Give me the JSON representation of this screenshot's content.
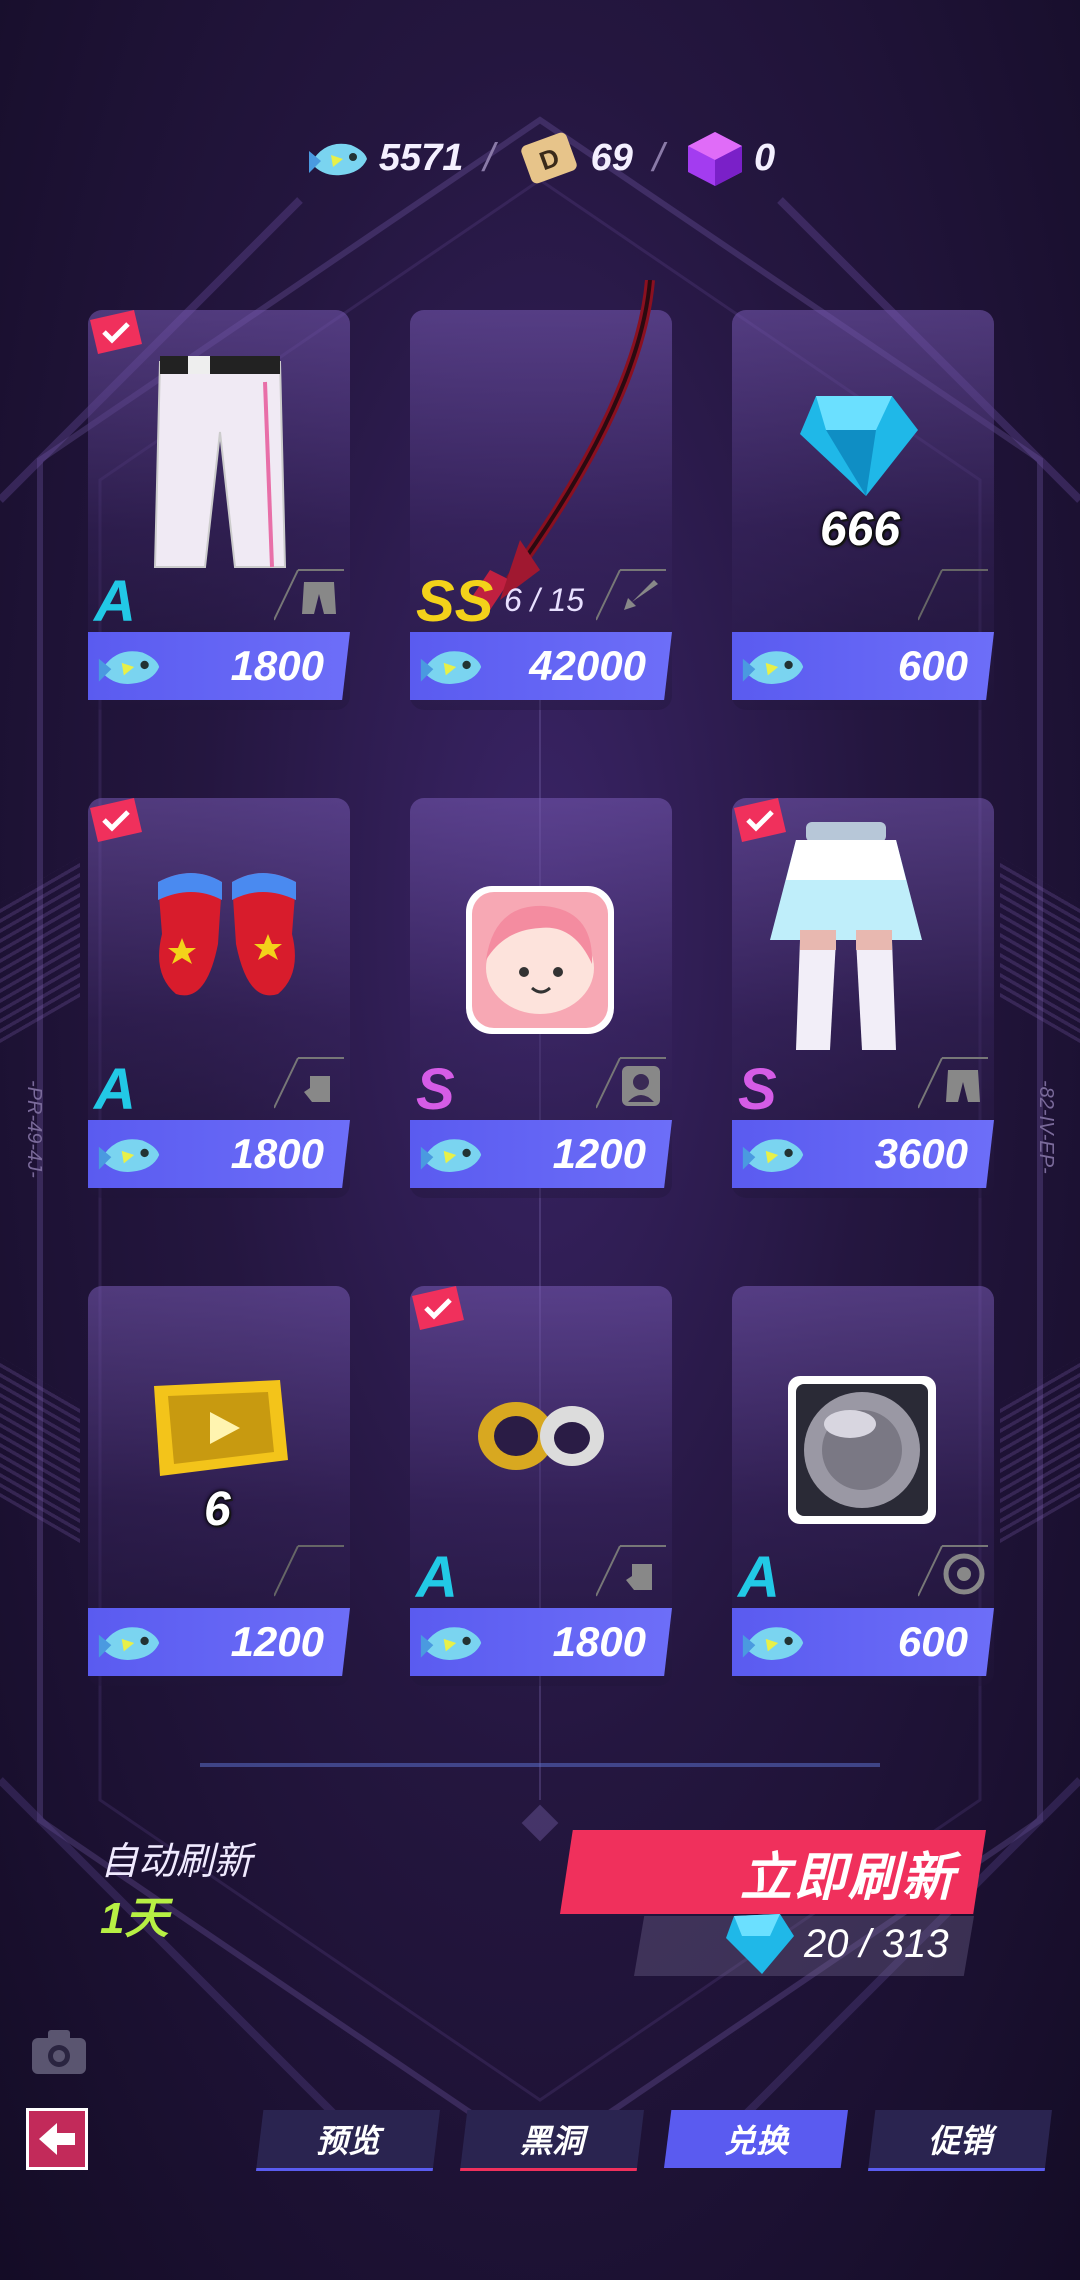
{
  "currencies": [
    {
      "icon": "fish-currency-icon",
      "value": "5571"
    },
    {
      "icon": "ticket-d-icon",
      "value": "69"
    },
    {
      "icon": "purple-cube-icon",
      "value": "0"
    }
  ],
  "separator": "/",
  "items": [
    {
      "name": "white-pants",
      "icon": "white-pants-icon",
      "rank": "A",
      "type_icon": "pants-type-icon",
      "price": "1800",
      "owned": true,
      "qty": "",
      "stock": ""
    },
    {
      "name": "red-scythe",
      "icon": "scythe-weapon-icon",
      "rank": "SS",
      "type_icon": "weapon-type-icon",
      "price": "42000",
      "owned": false,
      "qty": "",
      "stock": "6 / 15"
    },
    {
      "name": "blue-diamond",
      "icon": "diamond-icon",
      "rank": "",
      "type_icon": "",
      "price": "600",
      "owned": false,
      "qty": "666",
      "stock": ""
    },
    {
      "name": "red-gloves",
      "icon": "star-gloves-icon",
      "rank": "A",
      "type_icon": "glove-type-icon",
      "price": "1800",
      "owned": true,
      "qty": "",
      "stock": ""
    },
    {
      "name": "avatar-frame",
      "icon": "pink-avatar-icon",
      "rank": "S",
      "type_icon": "avatar-type-icon",
      "price": "1200",
      "owned": false,
      "qty": "",
      "stock": ""
    },
    {
      "name": "skirt-outfit",
      "icon": "skirt-outfit-icon",
      "rank": "S",
      "type_icon": "pants-type-icon",
      "price": "3600",
      "owned": true,
      "qty": "",
      "stock": ""
    },
    {
      "name": "video-ticket",
      "icon": "video-box-icon",
      "rank": "",
      "type_icon": "",
      "price": "1200",
      "owned": false,
      "qty": "6",
      "stock": ""
    },
    {
      "name": "rings",
      "icon": "rings-icon",
      "rank": "A",
      "type_icon": "glove-type-icon",
      "price": "1800",
      "owned": true,
      "qty": "",
      "stock": ""
    },
    {
      "name": "grey-orb",
      "icon": "grey-orb-icon",
      "rank": "A",
      "type_icon": "target-type-icon",
      "price": "600",
      "owned": false,
      "qty": "",
      "stock": ""
    }
  ],
  "side_codes": {
    "left": "-PR-49-4J-",
    "right": "-82-IV-EP-"
  },
  "refresh": {
    "auto_label": "自动刷新",
    "auto_value": "1天",
    "button_label": "立即刷新",
    "cost": "20 / 313"
  },
  "tabs": [
    {
      "label": "预览",
      "style": "normal"
    },
    {
      "label": "黑洞",
      "style": "red"
    },
    {
      "label": "兑换",
      "style": "active"
    },
    {
      "label": "促销",
      "style": "normal"
    }
  ],
  "colors": {
    "accent": "#5a5bf0",
    "refresh": "#f0305c",
    "rankA": "#22c9e6",
    "rankS": "#d55ce6",
    "rankSS": "#f3d21a",
    "days": "#b7f044"
  }
}
